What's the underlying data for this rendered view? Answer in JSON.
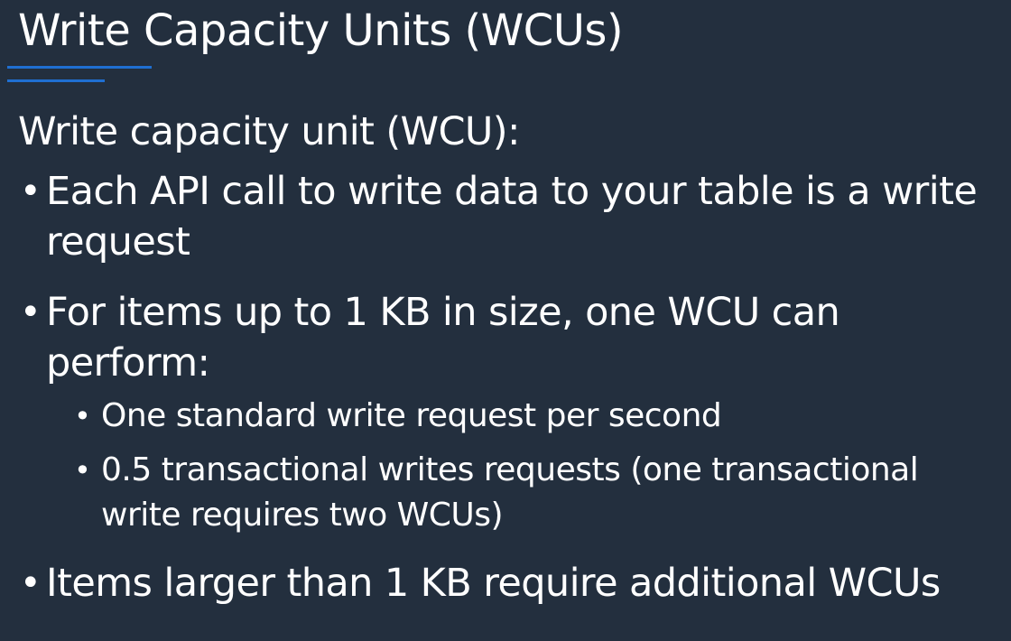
{
  "slide": {
    "title": "Write Capacity Units (WCUs)",
    "intro": "Write capacity unit (WCU):",
    "bullets": [
      {
        "text": "Each API call to write data to your table is a write request"
      },
      {
        "text": "For items up to 1 KB in size, one WCU can perform:",
        "sub_bullets": [
          "One standard write request per second",
          "0.5 transactional writes requests (one transactional write requires two WCUs)"
        ]
      },
      {
        "text": "Items larger than 1 KB require additional WCUs"
      }
    ]
  },
  "colors": {
    "background": "#232f3e",
    "text": "#ffffff",
    "accent": "#1f6fd1"
  }
}
